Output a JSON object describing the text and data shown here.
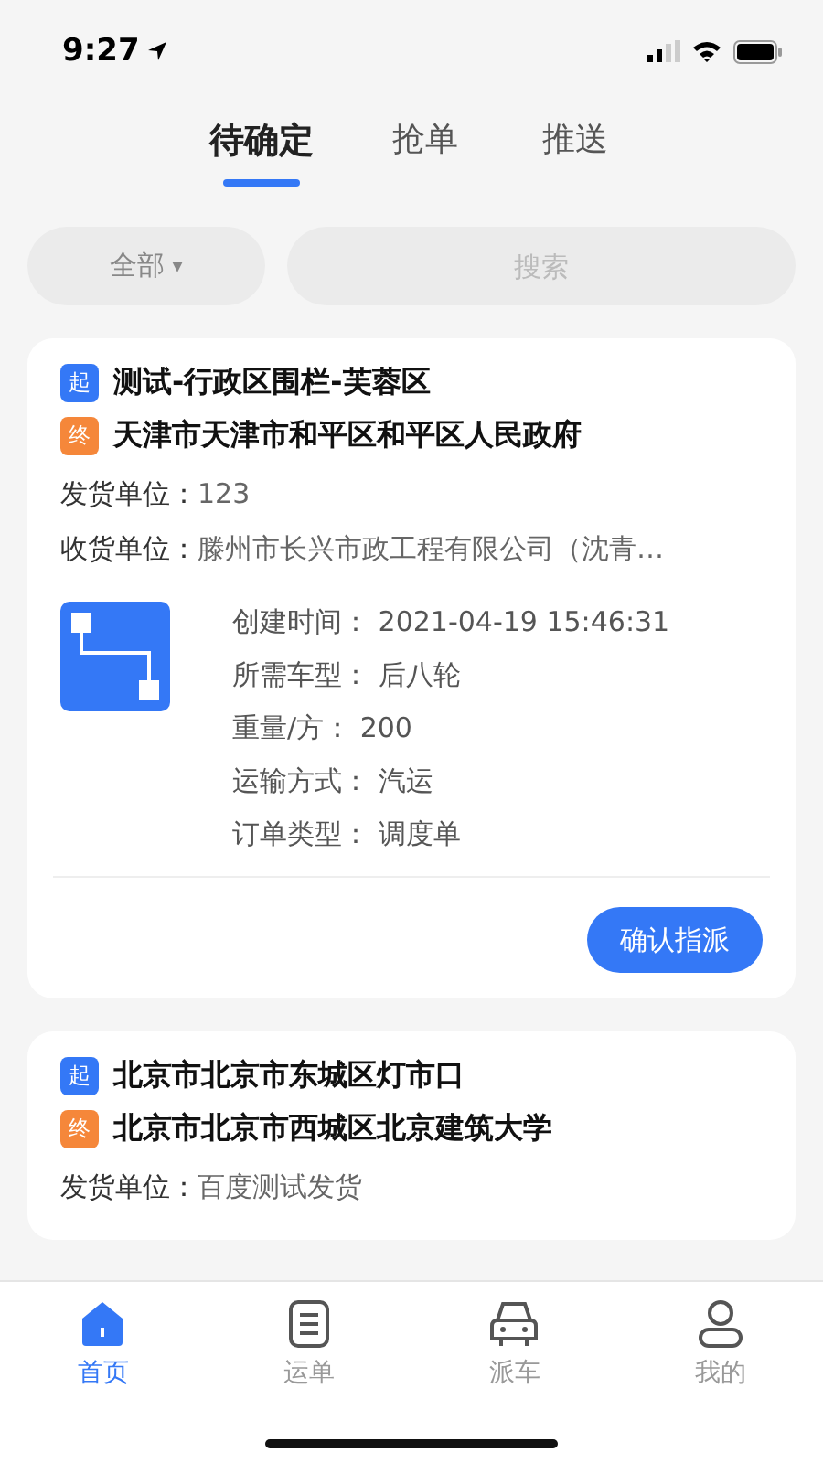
{
  "status_bar": {
    "time": "9:27"
  },
  "tabs": [
    {
      "label": "待确定",
      "selected": true
    },
    {
      "label": "抢单",
      "selected": false
    },
    {
      "label": "推送",
      "selected": false
    }
  ],
  "filter": {
    "label": "全部",
    "caret": "▾"
  },
  "search": {
    "placeholder": "搜索"
  },
  "orders": [
    {
      "stops": [
        {
          "kind": "start",
          "badge": "起",
          "address": "测试-行政区围栏-芙蓉区"
        },
        {
          "kind": "end",
          "badge": "终",
          "address": "天津市天津市和平区和平区人民政府"
        }
      ],
      "fields": [
        {
          "label": "发货单位：",
          "value": "123"
        },
        {
          "label": "收货单位：",
          "value": "滕州市长兴市政工程有限公司（沈青…"
        }
      ],
      "details": [
        {
          "label": "创建时间：",
          "value": "2021-04-19 15:46:31"
        },
        {
          "label": "所需车型：",
          "value": "后八轮"
        },
        {
          "label": "重量/方：",
          "value": "200"
        },
        {
          "label": "运输方式：",
          "value": "汽运"
        },
        {
          "label": "订单类型：",
          "value": "调度单"
        }
      ],
      "action": "确认指派"
    },
    {
      "stops": [
        {
          "kind": "start",
          "badge": "起",
          "address": "北京市北京市东城区灯市口"
        },
        {
          "kind": "end",
          "badge": "终",
          "address": "北京市北京市西城区北京建筑大学"
        }
      ],
      "fields": [
        {
          "label": "发货单位：",
          "value": "百度测试发货"
        }
      ]
    }
  ],
  "nav": [
    {
      "kind": "home",
      "label": "首页",
      "selected": true
    },
    {
      "kind": "list",
      "label": "运单",
      "selected": false
    },
    {
      "kind": "car",
      "label": "派车",
      "selected": false
    },
    {
      "kind": "user",
      "label": "我的",
      "selected": false
    }
  ]
}
